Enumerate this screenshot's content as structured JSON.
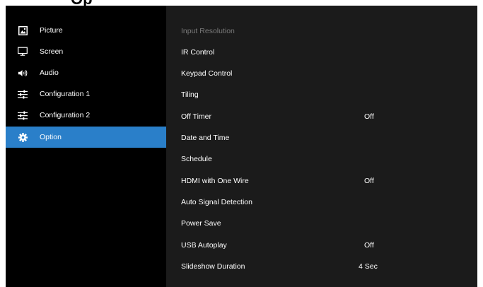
{
  "header": {
    "partial_title": "Op"
  },
  "sidebar": {
    "items": [
      {
        "label": "Picture",
        "icon": "picture-icon"
      },
      {
        "label": "Screen",
        "icon": "monitor-icon"
      },
      {
        "label": "Audio",
        "icon": "speaker-icon"
      },
      {
        "label": "Configuration 1",
        "icon": "sliders-icon"
      },
      {
        "label": "Configuration 2",
        "icon": "sliders-icon"
      },
      {
        "label": "Option",
        "icon": "gear-icon",
        "selected": true
      }
    ]
  },
  "main": {
    "options": [
      {
        "label": "Input Resolution",
        "value": "",
        "disabled": true
      },
      {
        "label": "IR Control",
        "value": ""
      },
      {
        "label": "Keypad Control",
        "value": ""
      },
      {
        "label": "Tiling",
        "value": ""
      },
      {
        "label": "Off Timer",
        "value": "Off"
      },
      {
        "label": "Date and Time",
        "value": ""
      },
      {
        "label": "Schedule",
        "value": ""
      },
      {
        "label": "HDMI with One Wire",
        "value": "Off"
      },
      {
        "label": "Auto Signal Detection",
        "value": ""
      },
      {
        "label": "Power Save",
        "value": ""
      },
      {
        "label": "USB Autoplay",
        "value": "Off"
      },
      {
        "label": "Slideshow Duration",
        "value": "4 Sec"
      }
    ]
  },
  "colors": {
    "selected_background": "#2a7fc9",
    "sidebar_background": "#000000",
    "main_background": "#1b1b1b",
    "disabled_text": "#7a7a7a"
  }
}
